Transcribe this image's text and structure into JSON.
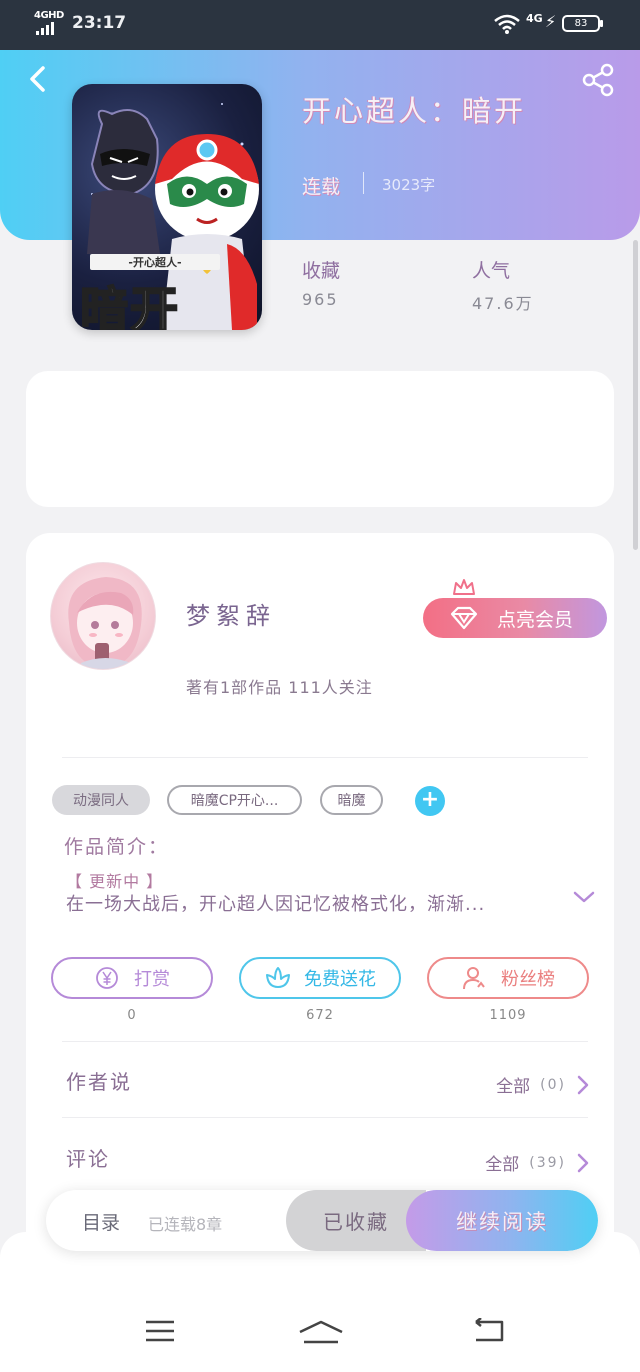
{
  "status_bar": {
    "network": "4GHD",
    "time": "23:17",
    "cellular": "4G",
    "battery": "83"
  },
  "book": {
    "title": "开心超人：暗开",
    "status": "连载",
    "word_count": "3023字",
    "cover_text_small": "-开心超人-",
    "cover_text_big": "暗开",
    "stats": {
      "favorites_label": "收藏",
      "favorites_value": "965",
      "popularity_label": "人气",
      "popularity_value": "47.6万"
    }
  },
  "author": {
    "name": "梦絮辞",
    "meta": "著有1部作品  111人关注",
    "vip_label": "点亮会员"
  },
  "tags": [
    "动漫同人",
    "暗魔CP开心...",
    "暗魔"
  ],
  "intro": {
    "label": "作品简介：",
    "badge": "【 更新中 】",
    "text": "在一场大战后，开心超人因记忆被格式化，渐渐..."
  },
  "actions": [
    {
      "label": "打赏",
      "count": "0",
      "color": "#b58ad8"
    },
    {
      "label": "免费送花",
      "count": "672",
      "color": "#4fc6ea"
    },
    {
      "label": "粉丝榜",
      "count": "1109",
      "color": "#ee8a8a"
    }
  ],
  "sections": {
    "author_says": {
      "title": "作者说",
      "link": "全部",
      "count": "(0)"
    },
    "comments": {
      "title": "评论",
      "link": "全部",
      "count": "(39)"
    }
  },
  "bottom_bar": {
    "toc": "目录",
    "chapters": "已连载8章",
    "collected": "已收藏",
    "continue": "继续阅读"
  },
  "colors": {
    "accent_blue": "#4fcff4",
    "accent_purple": "#b99be9",
    "vip_pink": "#f36f85"
  }
}
